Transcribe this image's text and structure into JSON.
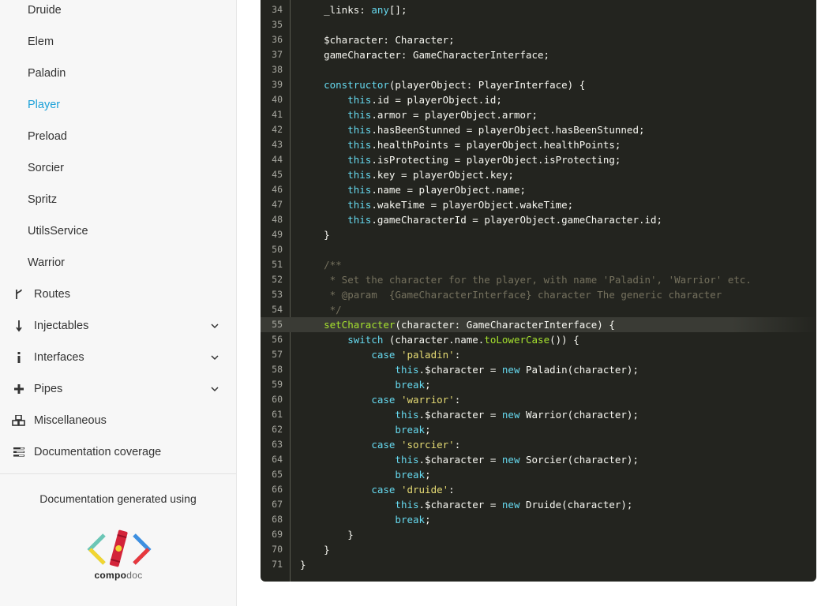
{
  "sidebar": {
    "sub_items": [
      {
        "label": "Druide",
        "active": false
      },
      {
        "label": "Elem",
        "active": false
      },
      {
        "label": "Paladin",
        "active": false
      },
      {
        "label": "Player",
        "active": true
      },
      {
        "label": "Preload",
        "active": false
      },
      {
        "label": "Sorcier",
        "active": false
      },
      {
        "label": "Spritz",
        "active": false
      },
      {
        "label": "UtilsService",
        "active": false
      },
      {
        "label": "Warrior",
        "active": false
      }
    ],
    "sections": [
      {
        "label": "Routes",
        "icon": "fork-icon",
        "expandable": false
      },
      {
        "label": "Injectables",
        "icon": "arrow-down-icon",
        "expandable": true
      },
      {
        "label": "Interfaces",
        "icon": "info-icon",
        "expandable": true
      },
      {
        "label": "Pipes",
        "icon": "plus-icon",
        "expandable": true
      },
      {
        "label": "Miscellaneous",
        "icon": "cubes-icon",
        "expandable": false
      },
      {
        "label": "Documentation coverage",
        "icon": "tasks-icon",
        "expandable": false
      }
    ],
    "footer_text": "Documentation generated using",
    "logo": {
      "bold": "compo",
      "light": "doc"
    }
  },
  "code": {
    "highlighted_line": 55,
    "lines": [
      {
        "n": "34",
        "tokens": [
          [
            "t",
            "    _links: "
          ],
          [
            "kw",
            "any"
          ],
          [
            "t",
            "[];"
          ]
        ]
      },
      {
        "n": "35",
        "tokens": []
      },
      {
        "n": "36",
        "tokens": [
          [
            "t",
            "    $character: Character;"
          ]
        ]
      },
      {
        "n": "37",
        "tokens": [
          [
            "t",
            "    gameCharacter: GameCharacterInterface;"
          ]
        ]
      },
      {
        "n": "38",
        "tokens": []
      },
      {
        "n": "39",
        "tokens": [
          [
            "t",
            "    "
          ],
          [
            "kw",
            "constructor"
          ],
          [
            "t",
            "(playerObject: PlayerInterface) {"
          ]
        ]
      },
      {
        "n": "40",
        "tokens": [
          [
            "t",
            "        "
          ],
          [
            "kw",
            "this"
          ],
          [
            "t",
            ".id = playerObject.id;"
          ]
        ]
      },
      {
        "n": "41",
        "tokens": [
          [
            "t",
            "        "
          ],
          [
            "kw",
            "this"
          ],
          [
            "t",
            ".armor = playerObject.armor;"
          ]
        ]
      },
      {
        "n": "42",
        "tokens": [
          [
            "t",
            "        "
          ],
          [
            "kw",
            "this"
          ],
          [
            "t",
            ".hasBeenStunned = playerObject.hasBeenStunned;"
          ]
        ]
      },
      {
        "n": "43",
        "tokens": [
          [
            "t",
            "        "
          ],
          [
            "kw",
            "this"
          ],
          [
            "t",
            ".healthPoints = playerObject.healthPoints;"
          ]
        ]
      },
      {
        "n": "44",
        "tokens": [
          [
            "t",
            "        "
          ],
          [
            "kw",
            "this"
          ],
          [
            "t",
            ".isProtecting = playerObject.isProtecting;"
          ]
        ]
      },
      {
        "n": "45",
        "tokens": [
          [
            "t",
            "        "
          ],
          [
            "kw",
            "this"
          ],
          [
            "t",
            ".key = playerObject.key;"
          ]
        ]
      },
      {
        "n": "46",
        "tokens": [
          [
            "t",
            "        "
          ],
          [
            "kw",
            "this"
          ],
          [
            "t",
            ".name = playerObject.name;"
          ]
        ]
      },
      {
        "n": "47",
        "tokens": [
          [
            "t",
            "        "
          ],
          [
            "kw",
            "this"
          ],
          [
            "t",
            ".wakeTime = playerObject.wakeTime;"
          ]
        ]
      },
      {
        "n": "48",
        "tokens": [
          [
            "t",
            "        "
          ],
          [
            "kw",
            "this"
          ],
          [
            "t",
            ".gameCharacterId = playerObject.gameCharacter.id;"
          ]
        ]
      },
      {
        "n": "49",
        "tokens": [
          [
            "t",
            "    }"
          ]
        ]
      },
      {
        "n": "50",
        "tokens": []
      },
      {
        "n": "51",
        "tokens": [
          [
            "cm",
            "    /**"
          ]
        ]
      },
      {
        "n": "52",
        "tokens": [
          [
            "cm",
            "     * Set the character for the player, with name 'Paladin', 'Warrior' etc."
          ]
        ]
      },
      {
        "n": "53",
        "tokens": [
          [
            "cm",
            "     * @param  {GameCharacterInterface} character The generic character"
          ]
        ]
      },
      {
        "n": "54",
        "tokens": [
          [
            "cm",
            "     */"
          ]
        ]
      },
      {
        "n": "55",
        "tokens": [
          [
            "t",
            "    "
          ],
          [
            "fn",
            "setCharacter"
          ],
          [
            "t",
            "(character: GameCharacterInterface) {"
          ]
        ]
      },
      {
        "n": "56",
        "tokens": [
          [
            "t",
            "        "
          ],
          [
            "kw",
            "switch"
          ],
          [
            "t",
            " (character.name."
          ],
          [
            "fn",
            "toLowerCase"
          ],
          [
            "t",
            "()) {"
          ]
        ]
      },
      {
        "n": "57",
        "tokens": [
          [
            "t",
            "            "
          ],
          [
            "kw",
            "case"
          ],
          [
            "t",
            " "
          ],
          [
            "str",
            "'paladin'"
          ],
          [
            "t",
            ":"
          ]
        ]
      },
      {
        "n": "58",
        "tokens": [
          [
            "t",
            "                "
          ],
          [
            "kw",
            "this"
          ],
          [
            "t",
            ".$character = "
          ],
          [
            "kw",
            "new"
          ],
          [
            "t",
            " Paladin(character);"
          ]
        ]
      },
      {
        "n": "59",
        "tokens": [
          [
            "t",
            "                "
          ],
          [
            "kw",
            "break"
          ],
          [
            "t",
            ";"
          ]
        ]
      },
      {
        "n": "60",
        "tokens": [
          [
            "t",
            "            "
          ],
          [
            "kw",
            "case"
          ],
          [
            "t",
            " "
          ],
          [
            "str",
            "'warrior'"
          ],
          [
            "t",
            ":"
          ]
        ]
      },
      {
        "n": "61",
        "tokens": [
          [
            "t",
            "                "
          ],
          [
            "kw",
            "this"
          ],
          [
            "t",
            ".$character = "
          ],
          [
            "kw",
            "new"
          ],
          [
            "t",
            " Warrior(character);"
          ]
        ]
      },
      {
        "n": "62",
        "tokens": [
          [
            "t",
            "                "
          ],
          [
            "kw",
            "break"
          ],
          [
            "t",
            ";"
          ]
        ]
      },
      {
        "n": "63",
        "tokens": [
          [
            "t",
            "            "
          ],
          [
            "kw",
            "case"
          ],
          [
            "t",
            " "
          ],
          [
            "str",
            "'sorcier'"
          ],
          [
            "t",
            ":"
          ]
        ]
      },
      {
        "n": "64",
        "tokens": [
          [
            "t",
            "                "
          ],
          [
            "kw",
            "this"
          ],
          [
            "t",
            ".$character = "
          ],
          [
            "kw",
            "new"
          ],
          [
            "t",
            " Sorcier(character);"
          ]
        ]
      },
      {
        "n": "65",
        "tokens": [
          [
            "t",
            "                "
          ],
          [
            "kw",
            "break"
          ],
          [
            "t",
            ";"
          ]
        ]
      },
      {
        "n": "66",
        "tokens": [
          [
            "t",
            "            "
          ],
          [
            "kw",
            "case"
          ],
          [
            "t",
            " "
          ],
          [
            "str",
            "'druide'"
          ],
          [
            "t",
            ":"
          ]
        ]
      },
      {
        "n": "67",
        "tokens": [
          [
            "t",
            "                "
          ],
          [
            "kw",
            "this"
          ],
          [
            "t",
            ".$character = "
          ],
          [
            "kw",
            "new"
          ],
          [
            "t",
            " Druide(character);"
          ]
        ]
      },
      {
        "n": "68",
        "tokens": [
          [
            "t",
            "                "
          ],
          [
            "kw",
            "break"
          ],
          [
            "t",
            ";"
          ]
        ]
      },
      {
        "n": "69",
        "tokens": [
          [
            "t",
            "        }"
          ]
        ]
      },
      {
        "n": "70",
        "tokens": [
          [
            "t",
            "    }"
          ]
        ]
      },
      {
        "n": "71",
        "tokens": [
          [
            "t",
            "}"
          ]
        ]
      }
    ]
  },
  "colors": {
    "accent": "#1ba0d8",
    "code_bg": "#23241f",
    "keyword": "#66d9ef",
    "string": "#e6db74",
    "function": "#a6e22e",
    "comment": "#75715e"
  }
}
